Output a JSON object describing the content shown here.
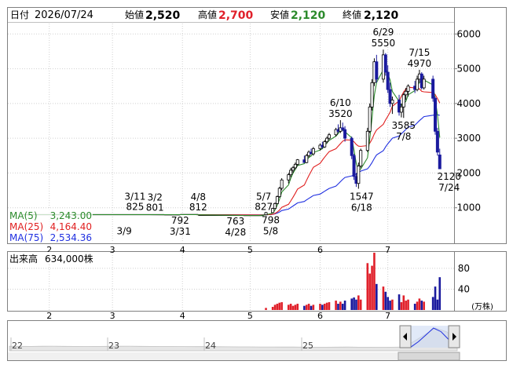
{
  "header": {
    "date_label": "日付",
    "date": "2026/07/24",
    "open_label": "始値",
    "open": "2,520",
    "high_label": "高値",
    "high": "2,700",
    "low_label": "安値",
    "low": "2,120",
    "close_label": "終値",
    "close": "2,120"
  },
  "legend": {
    "ma5_label": "MA(5)",
    "ma5_value": "3,243.00",
    "ma25_label": "MA(25)",
    "ma25_value": "4,164.40",
    "ma75_label": "MA(75)",
    "ma75_value": "2,534.36"
  },
  "volume_legend": {
    "label": "出来高",
    "value": "634,000株",
    "unit": "(万株)"
  },
  "colors": {
    "up": "#e0202a",
    "down": "#1a1a9e",
    "ma5": "#2b8a2b",
    "ma25": "#e02020",
    "ma75": "#2030e0",
    "grid": "#d0d0d0",
    "ma5_text": "#2b8a2b",
    "ma25_text": "#e02020",
    "ma75_text": "#2030e0",
    "high_text": "#e0202a",
    "low_text": "#2b8a2b"
  },
  "chart_data": [
    {
      "type": "candlestick",
      "title": "",
      "y_ticks": [
        "6000",
        "5000",
        "4000",
        "3000",
        "2000",
        "1000"
      ],
      "ylim": [
        0,
        6300
      ],
      "x_month_labels": [
        "2",
        "3",
        "4",
        "5",
        "6",
        "7"
      ],
      "x_month_dates": [
        "2026-02-01",
        "2026-03-01",
        "2026-04-01",
        "2026-05-01",
        "2026-06-01",
        "2026-07-01"
      ],
      "flat_price_periods": [
        {
          "from": "2026-01-20",
          "to": "2026-03-24",
          "value": 801
        },
        {
          "from": "2026-03-24",
          "to": "2026-03-31",
          "value": 795
        },
        {
          "from": "2026-03-31",
          "to": "2026-04-08",
          "value": 805
        },
        {
          "from": "2026-04-08",
          "to": "2026-04-28",
          "value": 780
        },
        {
          "from": "2026-04-28",
          "to": "2026-05-07",
          "value": 775
        }
      ],
      "candles": [
        {
          "date": "2026-05-08",
          "open": 798,
          "high": 880,
          "low": 798,
          "close": 860
        },
        {
          "date": "2026-05-11",
          "open": 860,
          "high": 1000,
          "low": 850,
          "close": 980
        },
        {
          "date": "2026-05-12",
          "open": 980,
          "high": 1150,
          "low": 960,
          "close": 1120
        },
        {
          "date": "2026-05-13",
          "open": 1120,
          "high": 1350,
          "low": 1100,
          "close": 1320
        },
        {
          "date": "2026-05-14",
          "open": 1320,
          "high": 1600,
          "low": 1290,
          "close": 1560
        },
        {
          "date": "2026-05-15",
          "open": 1560,
          "high": 1850,
          "low": 1500,
          "close": 1800
        },
        {
          "date": "2026-05-18",
          "open": 1800,
          "high": 2000,
          "low": 1700,
          "close": 1950
        },
        {
          "date": "2026-05-19",
          "open": 1950,
          "high": 2150,
          "low": 1880,
          "close": 2080
        },
        {
          "date": "2026-05-20",
          "open": 2080,
          "high": 2200,
          "low": 2000,
          "close": 2150
        },
        {
          "date": "2026-05-21",
          "open": 2150,
          "high": 2300,
          "low": 2100,
          "close": 2250
        },
        {
          "date": "2026-05-22",
          "open": 2250,
          "high": 2400,
          "low": 2200,
          "close": 2380
        },
        {
          "date": "2026-05-25",
          "open": 2380,
          "high": 2500,
          "low": 2300,
          "close": 2300
        },
        {
          "date": "2026-05-26",
          "open": 2300,
          "high": 2550,
          "low": 2280,
          "close": 2500
        },
        {
          "date": "2026-05-27",
          "open": 2500,
          "high": 2650,
          "low": 2450,
          "close": 2600
        },
        {
          "date": "2026-05-28",
          "open": 2600,
          "high": 2700,
          "low": 2550,
          "close": 2550
        },
        {
          "date": "2026-05-29",
          "open": 2550,
          "high": 2750,
          "low": 2500,
          "close": 2700
        },
        {
          "date": "2026-06-01",
          "open": 2700,
          "high": 2850,
          "low": 2650,
          "close": 2800
        },
        {
          "date": "2026-06-02",
          "open": 2800,
          "high": 2900,
          "low": 2700,
          "close": 2750
        },
        {
          "date": "2026-06-03",
          "open": 2750,
          "high": 2950,
          "low": 2720,
          "close": 2900
        },
        {
          "date": "2026-06-04",
          "open": 2900,
          "high": 3050,
          "low": 2850,
          "close": 3000
        },
        {
          "date": "2026-06-05",
          "open": 3000,
          "high": 3150,
          "low": 2950,
          "close": 3100
        },
        {
          "date": "2026-06-08",
          "open": 3100,
          "high": 3300,
          "low": 3050,
          "close": 3250
        },
        {
          "date": "2026-06-09",
          "open": 3250,
          "high": 3400,
          "low": 3150,
          "close": 3200
        },
        {
          "date": "2026-06-10",
          "open": 3200,
          "high": 3520,
          "low": 3150,
          "close": 3300
        },
        {
          "date": "2026-06-11",
          "open": 3300,
          "high": 3450,
          "low": 3200,
          "close": 3250
        },
        {
          "date": "2026-06-12",
          "open": 3250,
          "high": 3350,
          "low": 2900,
          "close": 3000
        },
        {
          "date": "2026-06-15",
          "open": 3000,
          "high": 3050,
          "low": 2400,
          "close": 2500
        },
        {
          "date": "2026-06-16",
          "open": 2500,
          "high": 2550,
          "low": 1800,
          "close": 1900
        },
        {
          "date": "2026-06-17",
          "open": 1900,
          "high": 2000,
          "low": 1600,
          "close": 1700
        },
        {
          "date": "2026-06-18",
          "open": 1700,
          "high": 2300,
          "low": 1547,
          "close": 2200
        },
        {
          "date": "2026-06-19",
          "open": 2200,
          "high": 2700,
          "low": 2150,
          "close": 2650
        },
        {
          "date": "2026-06-22",
          "open": 2650,
          "high": 3300,
          "low": 2600,
          "close": 3200
        },
        {
          "date": "2026-06-23",
          "open": 3200,
          "high": 4000,
          "low": 3150,
          "close": 3900
        },
        {
          "date": "2026-06-24",
          "open": 3900,
          "high": 4700,
          "low": 3800,
          "close": 4600
        },
        {
          "date": "2026-06-25",
          "open": 4600,
          "high": 5300,
          "low": 4500,
          "close": 5200
        },
        {
          "date": "2026-06-26",
          "open": 5200,
          "high": 5400,
          "low": 4600,
          "close": 4700
        },
        {
          "date": "2026-06-29",
          "open": 4700,
          "high": 5550,
          "low": 4600,
          "close": 5400
        },
        {
          "date": "2026-06-30",
          "open": 5400,
          "high": 5450,
          "low": 4800,
          "close": 4900
        },
        {
          "date": "2026-07-01",
          "open": 4900,
          "high": 5100,
          "low": 4300,
          "close": 4400
        },
        {
          "date": "2026-07-02",
          "open": 4400,
          "high": 4600,
          "low": 3900,
          "close": 4000
        },
        {
          "date": "2026-07-03",
          "open": 4000,
          "high": 4200,
          "low": 3700,
          "close": 4100
        },
        {
          "date": "2026-07-06",
          "open": 4100,
          "high": 4250,
          "low": 3650,
          "close": 3750
        },
        {
          "date": "2026-07-07",
          "open": 3750,
          "high": 4000,
          "low": 3600,
          "close": 3900
        },
        {
          "date": "2026-07-08",
          "open": 3900,
          "high": 4300,
          "low": 3585,
          "close": 4250
        },
        {
          "date": "2026-07-09",
          "open": 4250,
          "high": 4450,
          "low": 4100,
          "close": 4350
        },
        {
          "date": "2026-07-10",
          "open": 4350,
          "high": 4550,
          "low": 4200,
          "close": 4500
        },
        {
          "date": "2026-07-13",
          "open": 4500,
          "high": 4650,
          "low": 4300,
          "close": 4400
        },
        {
          "date": "2026-07-14",
          "open": 4400,
          "high": 4800,
          "low": 4350,
          "close": 4700
        },
        {
          "date": "2026-07-15",
          "open": 4700,
          "high": 4970,
          "low": 4600,
          "close": 4850
        },
        {
          "date": "2026-07-16",
          "open": 4850,
          "high": 4900,
          "low": 4400,
          "close": 4450
        },
        {
          "date": "2026-07-17",
          "open": 4450,
          "high": 4800,
          "low": 4400,
          "close": 4700
        },
        {
          "date": "2026-07-21",
          "open": 4700,
          "high": 4800,
          "low": 4050,
          "close": 4150
        },
        {
          "date": "2026-07-22",
          "open": 4150,
          "high": 4200,
          "low": 3100,
          "close": 3200
        },
        {
          "date": "2026-07-23",
          "open": 3200,
          "high": 3300,
          "low": 2500,
          "close": 2600
        },
        {
          "date": "2026-07-24",
          "open": 2520,
          "high": 2700,
          "low": 2120,
          "close": 2120
        }
      ],
      "annotations": [
        {
          "date": "2026-03-24",
          "value": 801,
          "label_top": "3/2",
          "label_bottom": "801"
        },
        {
          "date": "2026-03-11",
          "value": 825,
          "label_top": "3/11",
          "label_bottom": "825"
        },
        {
          "date": "2026-03-09",
          "value": 801,
          "label_top": "",
          "label_bottom": "3/9"
        },
        {
          "date": "2026-04-08",
          "value": 812,
          "label_top": "4/8",
          "label_bottom": "812"
        },
        {
          "date": "2026-03-31",
          "value": 792,
          "label_top": "792",
          "label_bottom": "3/31"
        },
        {
          "date": "2026-05-07",
          "value": 827,
          "label_top": "5/7",
          "label_bottom": "827"
        },
        {
          "date": "2026-04-28",
          "value": 763,
          "label_top": "763",
          "label_bottom": "4/28"
        },
        {
          "date": "2026-05-08",
          "value": 798,
          "label_top": "798",
          "label_bottom": "5/8"
        },
        {
          "date": "2026-06-10",
          "value": 3520,
          "label_top": "6/10",
          "label_bottom": "3520"
        },
        {
          "date": "2026-06-29",
          "value": 5550,
          "label_top": "6/29",
          "label_bottom": "5550"
        },
        {
          "date": "2026-07-15",
          "value": 4970,
          "label_top": "7/15",
          "label_bottom": "4970"
        },
        {
          "date": "2026-07-08",
          "value": 3585,
          "label_top": "3585",
          "label_bottom": "7/8"
        },
        {
          "date": "2026-06-18",
          "value": 1547,
          "label_top": "1547",
          "label_bottom": "6/18"
        },
        {
          "date": "2026-07-24",
          "value": 2120,
          "label_top": "2120",
          "label_bottom": "7/24"
        }
      ]
    },
    {
      "type": "bar",
      "title": "出来高",
      "y_ticks": [
        "80",
        "40"
      ],
      "ylim": [
        0,
        110
      ],
      "unit": "万株",
      "x_month_labels": [
        "2",
        "3",
        "4",
        "5",
        "6",
        "7"
      ],
      "bars": [
        {
          "date": "2026-05-08",
          "value": 4,
          "dir": "up"
        },
        {
          "date": "2026-05-11",
          "value": 6,
          "dir": "up"
        },
        {
          "date": "2026-05-12",
          "value": 10,
          "dir": "up"
        },
        {
          "date": "2026-05-13",
          "value": 12,
          "dir": "up"
        },
        {
          "date": "2026-05-14",
          "value": 14,
          "dir": "up"
        },
        {
          "date": "2026-05-15",
          "value": 15,
          "dir": "up"
        },
        {
          "date": "2026-05-18",
          "value": 10,
          "dir": "up"
        },
        {
          "date": "2026-05-19",
          "value": 12,
          "dir": "up"
        },
        {
          "date": "2026-05-20",
          "value": 8,
          "dir": "up"
        },
        {
          "date": "2026-05-21",
          "value": 10,
          "dir": "up"
        },
        {
          "date": "2026-05-22",
          "value": 12,
          "dir": "up"
        },
        {
          "date": "2026-05-25",
          "value": 8,
          "dir": "down"
        },
        {
          "date": "2026-05-26",
          "value": 10,
          "dir": "up"
        },
        {
          "date": "2026-05-27",
          "value": 12,
          "dir": "up"
        },
        {
          "date": "2026-05-28",
          "value": 8,
          "dir": "down"
        },
        {
          "date": "2026-05-29",
          "value": 10,
          "dir": "up"
        },
        {
          "date": "2026-06-01",
          "value": 12,
          "dir": "up"
        },
        {
          "date": "2026-06-02",
          "value": 10,
          "dir": "down"
        },
        {
          "date": "2026-06-03",
          "value": 12,
          "dir": "up"
        },
        {
          "date": "2026-06-04",
          "value": 14,
          "dir": "up"
        },
        {
          "date": "2026-06-05",
          "value": 15,
          "dir": "up"
        },
        {
          "date": "2026-06-08",
          "value": 18,
          "dir": "up"
        },
        {
          "date": "2026-06-09",
          "value": 12,
          "dir": "down"
        },
        {
          "date": "2026-06-10",
          "value": 16,
          "dir": "up"
        },
        {
          "date": "2026-06-11",
          "value": 12,
          "dir": "down"
        },
        {
          "date": "2026-06-12",
          "value": 18,
          "dir": "down"
        },
        {
          "date": "2026-06-15",
          "value": 22,
          "dir": "down"
        },
        {
          "date": "2026-06-16",
          "value": 24,
          "dir": "down"
        },
        {
          "date": "2026-06-17",
          "value": 20,
          "dir": "down"
        },
        {
          "date": "2026-06-18",
          "value": 28,
          "dir": "up"
        },
        {
          "date": "2026-06-19",
          "value": 20,
          "dir": "up"
        },
        {
          "date": "2026-06-22",
          "value": 90,
          "dir": "up"
        },
        {
          "date": "2026-06-23",
          "value": 70,
          "dir": "up"
        },
        {
          "date": "2026-06-24",
          "value": 85,
          "dir": "up"
        },
        {
          "date": "2026-06-25",
          "value": 110,
          "dir": "up"
        },
        {
          "date": "2026-06-26",
          "value": 50,
          "dir": "down"
        },
        {
          "date": "2026-06-29",
          "value": 45,
          "dir": "up"
        },
        {
          "date": "2026-06-30",
          "value": 35,
          "dir": "down"
        },
        {
          "date": "2026-07-01",
          "value": 25,
          "dir": "down"
        },
        {
          "date": "2026-07-02",
          "value": 18,
          "dir": "down"
        },
        {
          "date": "2026-07-03",
          "value": 20,
          "dir": "up"
        },
        {
          "date": "2026-07-06",
          "value": 30,
          "dir": "down"
        },
        {
          "date": "2026-07-07",
          "value": 15,
          "dir": "up"
        },
        {
          "date": "2026-07-08",
          "value": 28,
          "dir": "up"
        },
        {
          "date": "2026-07-09",
          "value": 18,
          "dir": "up"
        },
        {
          "date": "2026-07-10",
          "value": 20,
          "dir": "up"
        },
        {
          "date": "2026-07-13",
          "value": 12,
          "dir": "down"
        },
        {
          "date": "2026-07-14",
          "value": 16,
          "dir": "up"
        },
        {
          "date": "2026-07-15",
          "value": 22,
          "dir": "up"
        },
        {
          "date": "2026-07-16",
          "value": 18,
          "dir": "down"
        },
        {
          "date": "2026-07-17",
          "value": 16,
          "dir": "up"
        },
        {
          "date": "2026-07-21",
          "value": 25,
          "dir": "down"
        },
        {
          "date": "2026-07-22",
          "value": 45,
          "dir": "down"
        },
        {
          "date": "2026-07-23",
          "value": 20,
          "dir": "down"
        },
        {
          "date": "2026-07-24",
          "value": 63,
          "dir": "down"
        }
      ]
    },
    {
      "type": "area",
      "title": "",
      "x_labels": [
        "22",
        "23",
        "24",
        "25"
      ],
      "note": "long-term overview navigator"
    }
  ],
  "overview_values": [
    1000,
    980,
    960,
    1000,
    1020,
    990,
    970,
    950,
    960,
    980,
    1000,
    1010,
    990,
    970,
    950,
    940,
    930,
    920,
    910,
    900,
    880,
    870,
    860,
    850,
    840,
    830,
    820,
    810,
    800,
    800,
    810,
    820,
    800,
    790,
    780,
    800,
    820,
    2000,
    3500,
    5000,
    4200,
    2500
  ]
}
